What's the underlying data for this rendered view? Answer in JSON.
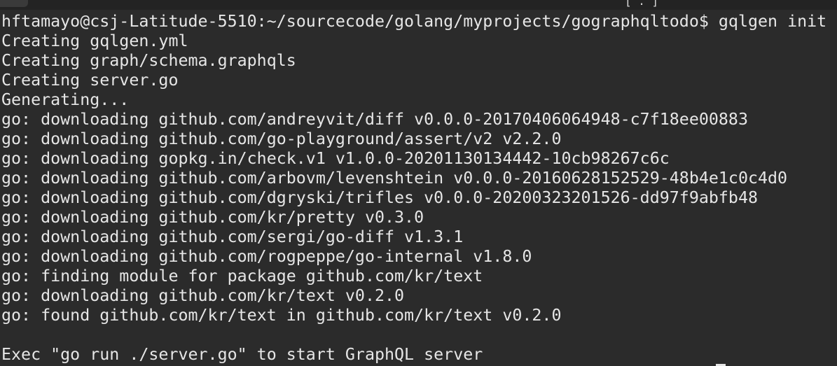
{
  "titlebar": {
    "glyph": "[ . ]"
  },
  "terminal": {
    "prompt": "hftamayo@csj-Latitude-5510:~/sourcecode/golang/myprojects/gographqltodo$ gqlgen init",
    "output": [
      "Creating gqlgen.yml",
      "Creating graph/schema.graphqls",
      "Creating server.go",
      "Generating...",
      "go: downloading github.com/andreyvit/diff v0.0.0-20170406064948-c7f18ee00883",
      "go: downloading github.com/go-playground/assert/v2 v2.2.0",
      "go: downloading gopkg.in/check.v1 v1.0.0-20201130134442-10cb98267c6c",
      "go: downloading github.com/arbovm/levenshtein v0.0.0-20160628152529-48b4e1c0c4d0",
      "go: downloading github.com/dgryski/trifles v0.0.0-20200323201526-dd97f9abfb48",
      "go: downloading github.com/kr/pretty v0.3.0",
      "go: downloading github.com/sergi/go-diff v1.3.1",
      "go: downloading github.com/rogpeppe/go-internal v1.8.0",
      "go: finding module for package github.com/kr/text",
      "go: downloading github.com/kr/text v0.2.0",
      "go: found github.com/kr/text in github.com/kr/text v0.2.0",
      "",
      "Exec \"go run ./server.go\" to start GraphQL server"
    ]
  },
  "colors": {
    "background": "#2b2b2b",
    "foreground": "#e6e6e6"
  }
}
